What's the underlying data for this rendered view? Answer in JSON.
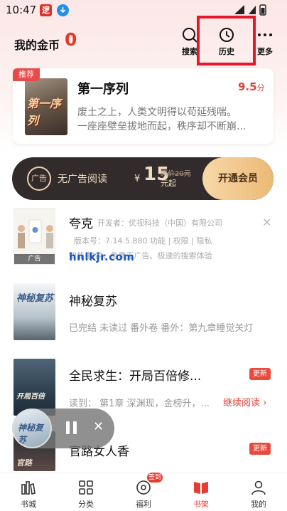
{
  "status_bar": {
    "time": "10:47",
    "app1_glyph": "逻"
  },
  "header": {
    "coin_label": "我的金币",
    "coin_value": "0",
    "search_label": "搜索",
    "history_label": "历史",
    "more_label": "更多"
  },
  "featured": {
    "tag": "推荐",
    "cover_text": "第一序列",
    "title": "第一序列",
    "score": "9.5",
    "score_unit": "分",
    "desc_line1": "废土之上，人类文明得以苟延残喘。",
    "desc_line2": "一座座壁垒拔地而起，秩序却不断崩..."
  },
  "vip": {
    "icon_text": "广告",
    "no_ad": "无广告阅读",
    "currency": "¥",
    "price": "15",
    "original": "原价20元",
    "unit": "元起",
    "button": "开通会员"
  },
  "ad_item": {
    "cover_label": "广告",
    "title": "夸克",
    "developer": "开发者：优视科技（中国）有限公司",
    "meta": "版本号：7.14.5.880   功能 | 权限 | 隐私",
    "desc": "智能·搜索，免费无广告、极速的搜索体验",
    "close": "✕",
    "watermark": "hnlkjr.com"
  },
  "books": [
    {
      "cover_text": "神秘复苏",
      "title": "神秘复苏",
      "info": "已完结 未读过 番外卷 番外：第九章睡觉关灯"
    },
    {
      "cover_text": "开局百倍",
      "title": "全民求生：开局百倍修...",
      "info": "读到： 第1章 深渊现，金榜升，...",
      "badge": "更新",
      "continue": "继续阅读 ›"
    },
    {
      "cover_text": "官路",
      "title": "官路女人香",
      "badge": "更新"
    }
  ],
  "player": {
    "disc_text": "神秘复苏",
    "close": "✕"
  },
  "nav": {
    "items": [
      "书城",
      "分类",
      "福利",
      "书架",
      "我的"
    ],
    "sign_badge": "签到",
    "active_index": 3
  },
  "colors": {
    "accent": "#e53c33",
    "highlight_box": "#e5162a",
    "vip_bg": "#322b2b",
    "vip_gold": "#ecb976"
  },
  "icons": [
    "search-icon",
    "clock-icon",
    "more-icon",
    "bookstore-icon",
    "category-icon",
    "gift-icon",
    "bookshelf-icon",
    "user-icon",
    "pause-icon",
    "close-icon"
  ]
}
